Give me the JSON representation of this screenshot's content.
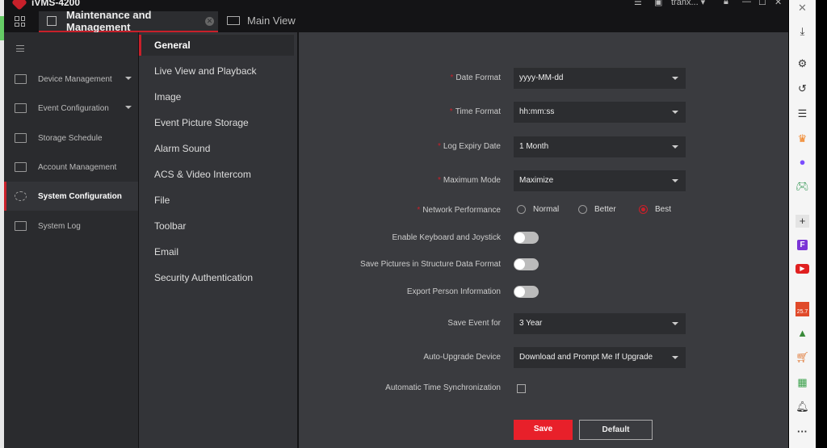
{
  "app": {
    "title": "iVMS-4200",
    "user": "tranx...",
    "brand_color": "#c8202a"
  },
  "tabs": [
    {
      "label": "Maintenance and Management",
      "active": true
    },
    {
      "label": "Main View"
    }
  ],
  "sidebar": {
    "items": [
      {
        "label": "Device Management",
        "icon": "device-icon",
        "expandable": true
      },
      {
        "label": "Event Configuration",
        "icon": "event-icon",
        "expandable": true
      },
      {
        "label": "Storage Schedule",
        "icon": "storage-icon"
      },
      {
        "label": "Account Management",
        "icon": "user-icon"
      },
      {
        "label": "System Configuration",
        "icon": "gear-icon",
        "active": true
      },
      {
        "label": "System Log",
        "icon": "log-icon"
      }
    ]
  },
  "submenu": {
    "items": [
      "General",
      "Live View and Playback",
      "Image",
      "Event Picture Storage",
      "Alarm Sound",
      "ACS & Video Intercom",
      "File",
      "Toolbar",
      "Email",
      "Security Authentication"
    ],
    "active": "General"
  },
  "form": {
    "date_format": {
      "label": "Date Format",
      "value": "yyyy-MM-dd"
    },
    "time_format": {
      "label": "Time Format",
      "value": "hh:mm:ss"
    },
    "log_expiry": {
      "label": "Log Expiry Date",
      "value": "1 Month"
    },
    "maximum_mode": {
      "label": "Maximum Mode",
      "value": "Maximize"
    },
    "network": {
      "label": "Network Performance",
      "options": [
        "Normal",
        "Better",
        "Best"
      ],
      "selected": "Best"
    },
    "keyboard": {
      "label": "Enable Keyboard and Joystick",
      "on": false
    },
    "structure": {
      "label": "Save Pictures in Structure Data Format",
      "on": false
    },
    "export_person": {
      "label": "Export Person Information",
      "on": false
    },
    "save_event": {
      "label": "Save Event for",
      "value": "3 Year"
    },
    "auto_upgrade": {
      "label": "Auto-Upgrade Device",
      "value": "Download and Prompt Me If Upgrade"
    },
    "time_sync": {
      "label": "Automatic Time Synchronization",
      "checked": false
    },
    "save_label": "Save",
    "default_label": "Default"
  },
  "edge_bar": {
    "badge": "25.7",
    "icons": [
      "close-icon",
      "download-icon",
      "gear-icon",
      "history-icon",
      "list-icon",
      "crown-icon",
      "messenger-icon",
      "game-icon",
      "plus-icon",
      "f-icon",
      "youtube-icon",
      "sale-icon",
      "hat-icon",
      "cart-icon",
      "sheet-icon",
      "bell-icon",
      "more-icon"
    ]
  }
}
